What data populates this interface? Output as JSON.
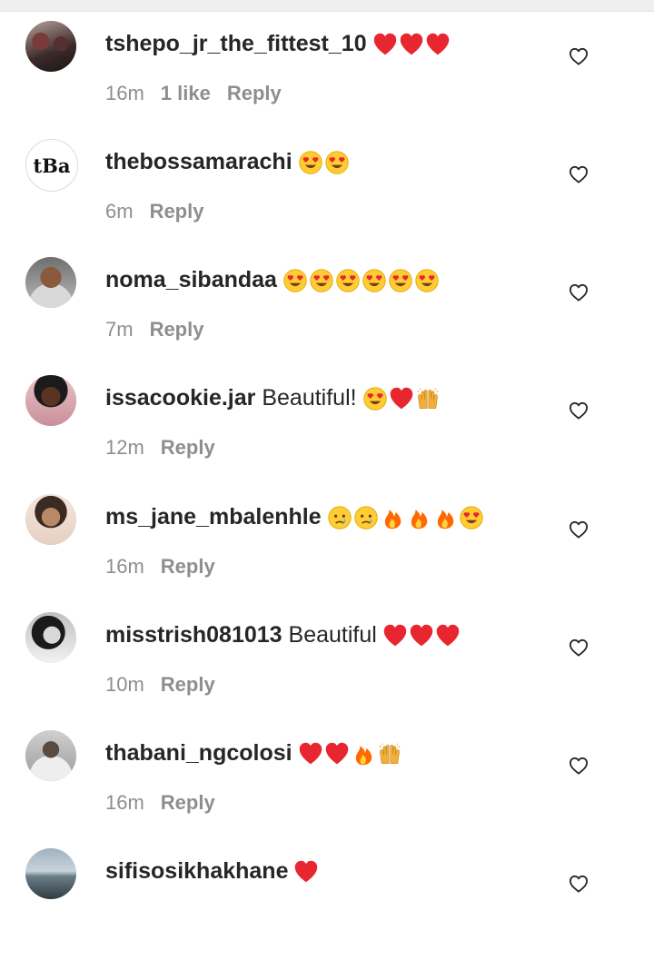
{
  "comments": [
    {
      "username": "tshepo_jr_the_fittest_10",
      "text": "",
      "emojis": [
        "heart",
        "heart",
        "heart"
      ],
      "time": "16m",
      "likes": "1 like",
      "reply": "Reply",
      "avatar": "photo"
    },
    {
      "username": "thebossamarachi",
      "text": "",
      "emojis": [
        "heart-eyes",
        "heart-eyes"
      ],
      "time": "6m",
      "likes": "",
      "reply": "Reply",
      "avatar": "text",
      "avatar_text": "tBa"
    },
    {
      "username": "noma_sibandaa",
      "text": "",
      "emojis": [
        "heart-eyes",
        "heart-eyes",
        "heart-eyes",
        "heart-eyes",
        "heart-eyes",
        "heart-eyes"
      ],
      "time": "7m",
      "likes": "",
      "reply": "Reply",
      "avatar": "photo"
    },
    {
      "username": "issacookie.jar",
      "text": "Beautiful!",
      "emojis": [
        "heart-eyes",
        "heart",
        "raising-hands"
      ],
      "time": "12m",
      "likes": "",
      "reply": "Reply",
      "avatar": "photo"
    },
    {
      "username": "ms_jane_mbalenhle",
      "text": "",
      "emojis": [
        "crying",
        "crying",
        "fire",
        "fire",
        "fire",
        "heart-eyes"
      ],
      "time": "16m",
      "likes": "",
      "reply": "Reply",
      "avatar": "photo"
    },
    {
      "username": "misstrish081013",
      "text": "Beautiful",
      "emojis": [
        "heart",
        "heart",
        "heart"
      ],
      "time": "10m",
      "likes": "",
      "reply": "Reply",
      "avatar": "photo"
    },
    {
      "username": "thabani_ngcolosi",
      "text": "",
      "emojis": [
        "heart",
        "heart",
        "fire",
        "raising-hands"
      ],
      "time": "16m",
      "likes": "",
      "reply": "Reply",
      "avatar": "photo"
    },
    {
      "username": "sifisosikhakhane",
      "text": "",
      "emojis": [
        "heart"
      ],
      "time": "",
      "likes": "",
      "reply": "",
      "avatar": "photo"
    }
  ],
  "colors": {
    "text": "#262626",
    "meta": "#8e8e8e",
    "heart": "#e8262f",
    "emoji_face": "#ffcc33",
    "fire": "#ff6a00"
  }
}
